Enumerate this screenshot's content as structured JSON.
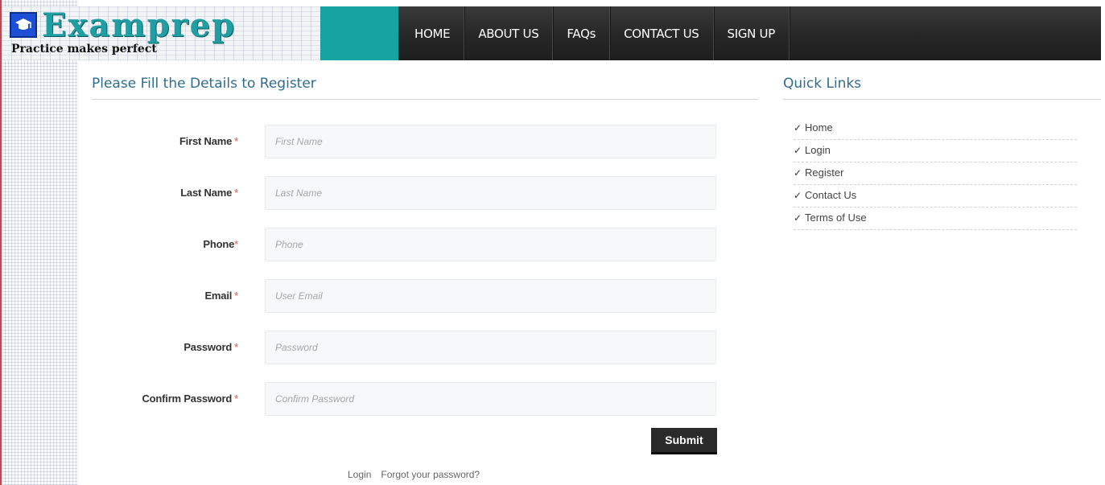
{
  "brand": {
    "name": "Examprep",
    "tagline": "Practice makes perfect",
    "icon": "graduation-cap-icon"
  },
  "nav": {
    "items": [
      {
        "label": "HOME"
      },
      {
        "label": "ABOUT US"
      },
      {
        "label": "FAQs"
      },
      {
        "label": "CONTACT US"
      },
      {
        "label": "SIGN UP"
      }
    ]
  },
  "form": {
    "title": "Please Fill the Details to Register",
    "required_marker": "*",
    "fields": [
      {
        "label": "First Name",
        "placeholder": "First Name",
        "value": ""
      },
      {
        "label": "Last Name",
        "placeholder": "Last Name",
        "value": ""
      },
      {
        "label": "Phone",
        "placeholder": "Phone",
        "value": ""
      },
      {
        "label": "Email",
        "placeholder": "User Email",
        "value": ""
      },
      {
        "label": "Password",
        "placeholder": "Password",
        "value": ""
      },
      {
        "label": "Confirm Password",
        "placeholder": "Confirm Password",
        "value": ""
      }
    ],
    "submit_label": "Submit",
    "login_link": "Login",
    "forgot_link": "Forgot your password?"
  },
  "quick_links": {
    "title": "Quick Links",
    "check_icon": "checkmark-icon",
    "items": [
      {
        "label": "Home"
      },
      {
        "label": "Login"
      },
      {
        "label": "Register"
      },
      {
        "label": "Contact Us"
      },
      {
        "label": "Terms of Use"
      }
    ]
  },
  "colors": {
    "accent_teal": "#16a4a2",
    "nav_dark": "#262626",
    "title_blue": "#2e6d8f",
    "required_red": "#d9534f",
    "logo_blue": "#1d4fd6"
  }
}
